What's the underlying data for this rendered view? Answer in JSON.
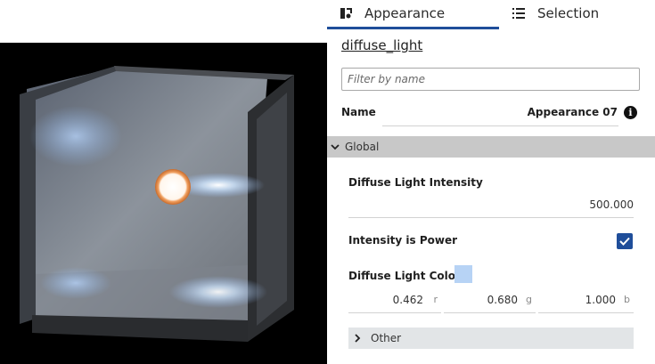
{
  "tabs": [
    {
      "label": "Appearance",
      "icon": "appearance-icon",
      "active": true
    },
    {
      "label": "Selection",
      "icon": "list-icon",
      "active": false
    }
  ],
  "panel": {
    "title": "diffuse_light",
    "filter_placeholder": "Filter by name",
    "name_label": "Name",
    "name_value": "Appearance 07",
    "global_section": "Global",
    "other_section": "Other"
  },
  "properties": {
    "intensity_label": "Diffuse Light Intensity",
    "intensity_value": "500.000",
    "power_label": "Intensity is Power",
    "power_checked": true,
    "color_label": "Diffuse Light Color",
    "color_swatch": "#b7d3f5",
    "r_value": "0.462",
    "g_value": "0.680",
    "b_value": "1.000",
    "r_unit": "r",
    "g_unit": "g",
    "b_unit": "b"
  },
  "colors": {
    "accent": "#1f4e9a",
    "section_bar": "#c8c8c8",
    "other_bar": "#e2e5e7"
  }
}
